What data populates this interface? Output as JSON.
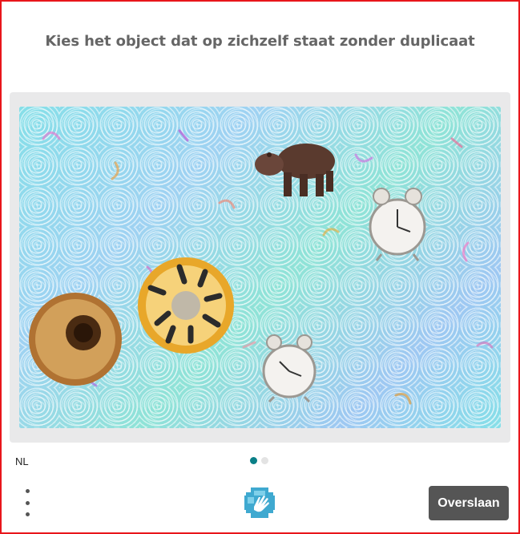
{
  "challenge": {
    "prompt": "Kies het object dat op zichzelf staat zonder duplicaat",
    "objects": [
      {
        "name": "hippo",
        "kind": "animal"
      },
      {
        "name": "alarm-clock",
        "kind": "clock"
      },
      {
        "name": "alarm-clock",
        "kind": "clock"
      },
      {
        "name": "donut",
        "kind": "plain"
      },
      {
        "name": "donut",
        "kind": "cookies-and-cream"
      }
    ]
  },
  "footer": {
    "language": "NL",
    "pagination": {
      "total": 2,
      "current": 1
    },
    "skip_label": "Overslaan",
    "logo_icon": "hand-logo-icon",
    "menu_icon": "more-vertical-icon"
  },
  "colors": {
    "frame_border": "#e8161b",
    "prompt_text": "#666666",
    "panel_bg": "#e9e9ea",
    "button_bg": "#555555",
    "dot_active": "#0a7f87",
    "dot_inactive": "#e3e3e3"
  }
}
